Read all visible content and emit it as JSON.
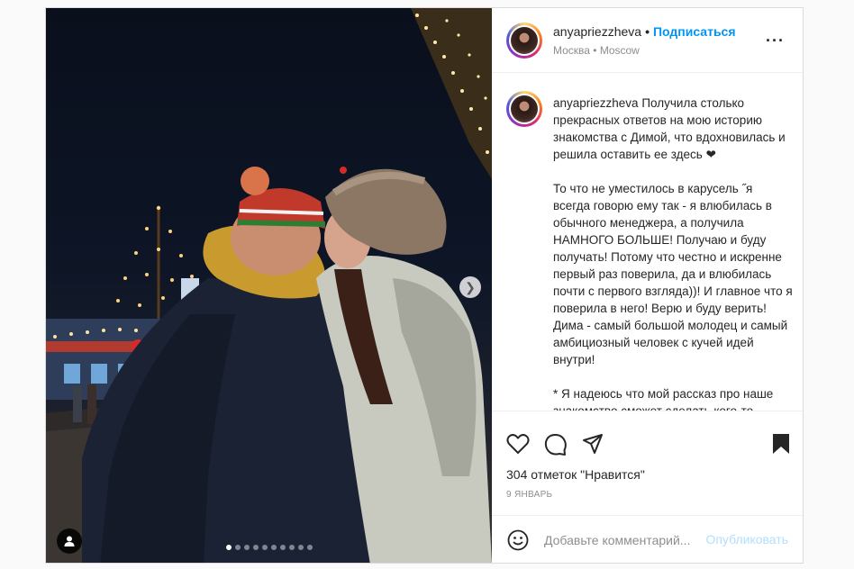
{
  "post": {
    "media": {
      "carousel_total": 10,
      "carousel_active_index": 0,
      "next_icon": "chevron-right-icon",
      "user_tag_icon": "person-icon"
    },
    "header": {
      "username": "anyapriezzheva",
      "separator": "•",
      "follow_label": "Подписаться",
      "location": "Москва • Moscow",
      "more_icon": "more-options-icon"
    },
    "caption": {
      "username": "anyapriezzheva",
      "text": "Получила столько прекрасных ответов на мою историю знакомства с Димой, что вдохновилась и решила оставить ее здесь ❤\n\nТо что не уместилось в карусель ˝я всегда говорю ему так - я влюбилась в обычного менеджера, а получила НАМНОГО БОЛЬШЕ! Получаю и буду получать! Потому что честно и искренне первый раз поверила, да и влюбилась почти с первого взгляда))! И главное что я поверила в него! Верю и буду верить! Дима - самый большой молодец и самый амбициозный человек с кучей идей внутри!\n\n* Я надеюсь что мой рассказ про наше знакомство сможет сделать кого-то"
    },
    "actions": {
      "like_icon": "heart-icon",
      "comment_icon": "comment-icon",
      "share_icon": "share-icon",
      "save_icon": "bookmark-icon",
      "likes_text": "304 отметок \"Нравится\"",
      "date_text": "9 ЯНВАРЬ"
    },
    "comment": {
      "emoji_icon": "emoji-icon",
      "placeholder": "Добавьте комментарий...",
      "publish_label": "Опубликовать"
    }
  }
}
